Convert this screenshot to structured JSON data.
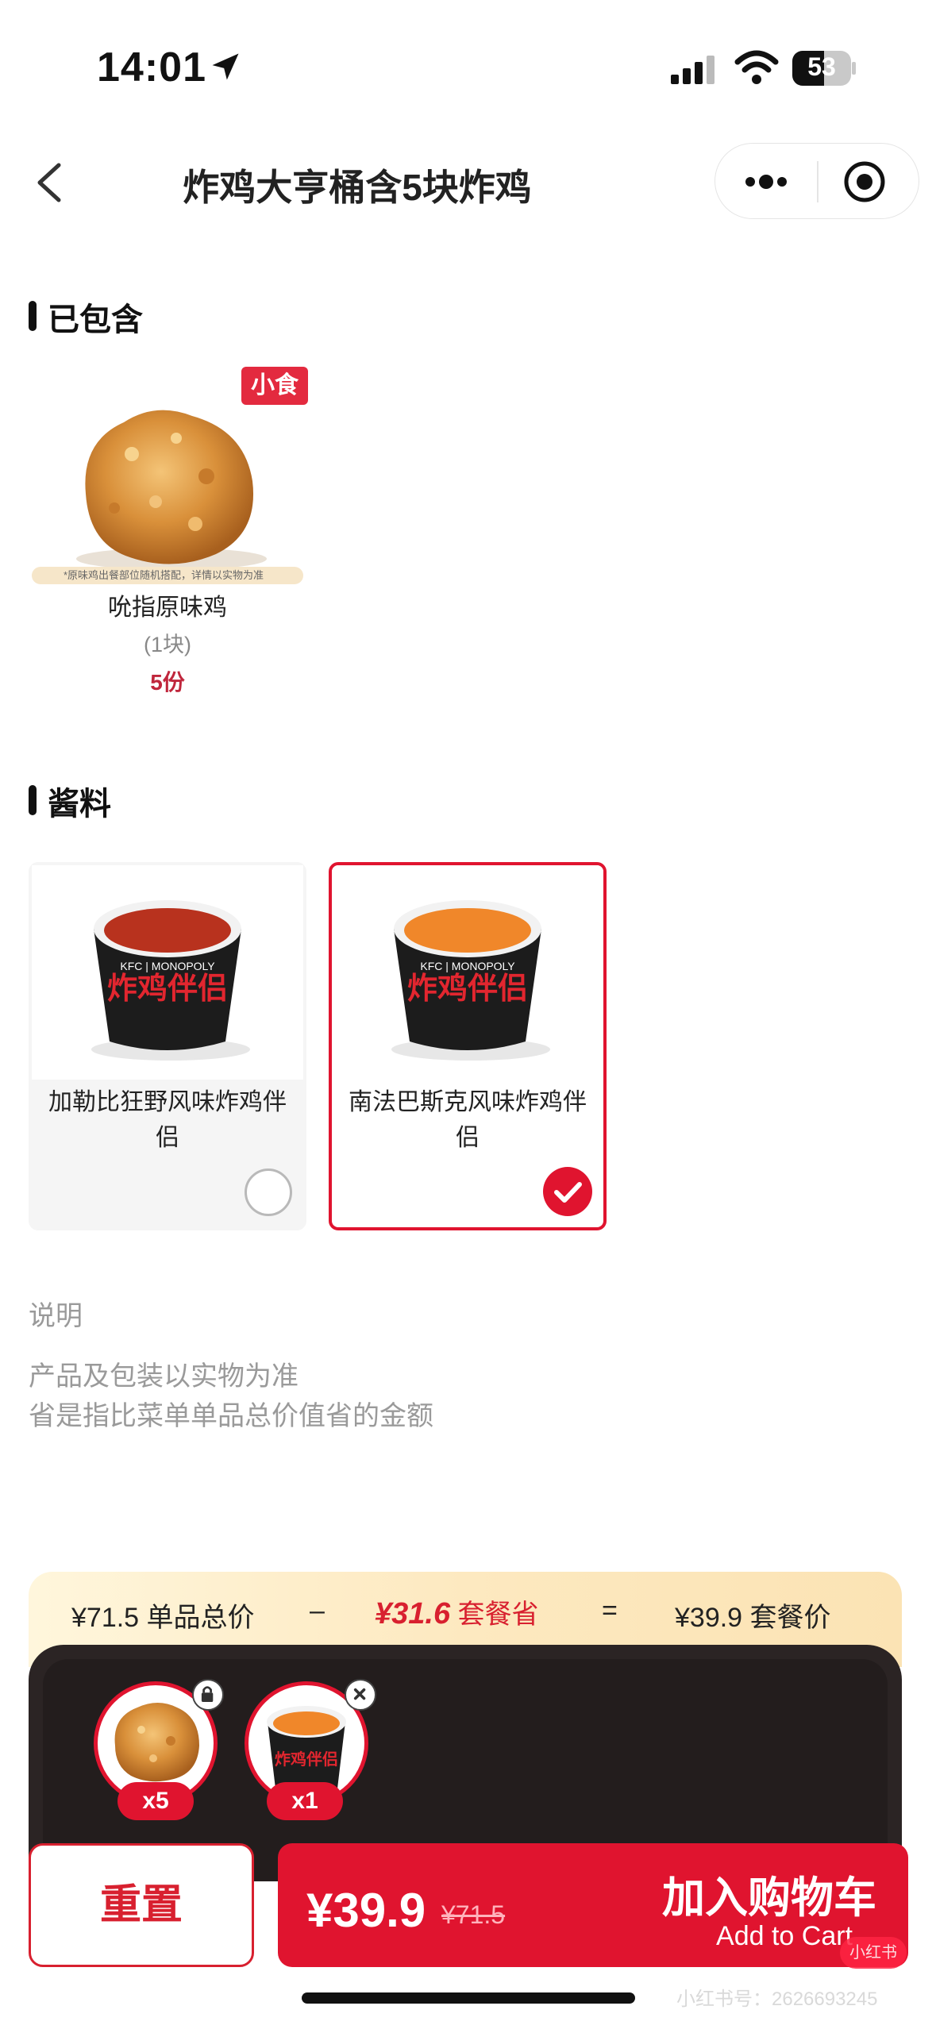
{
  "status": {
    "time": "14:01",
    "battery": "53"
  },
  "nav": {
    "title": "炸鸡大亨桶含5块炸鸡"
  },
  "included": {
    "heading": "已包含",
    "items": [
      {
        "tag": "小食",
        "note": "*原味鸡出餐部位随机搭配，详情以实物为准",
        "name": "吮指原味鸡",
        "unit": "(1块)",
        "qty": "5份"
      }
    ]
  },
  "sauce": {
    "heading": "酱料",
    "options": [
      {
        "name": "加勒比狂野风味炸鸡伴侣",
        "selected": false,
        "sauce_color": "#b8321e"
      },
      {
        "name": "南法巴斯克风味炸鸡伴侣",
        "selected": true,
        "sauce_color": "#f0872a"
      }
    ],
    "cup_label": "炸鸡伴侣",
    "cup_brand": "KFC | MONOPOLY"
  },
  "description": {
    "title": "说明",
    "lines": [
      "产品及包装以实物为准",
      "省是指比菜单单品总价值省的金额"
    ]
  },
  "summary": {
    "total_value": "¥71.5",
    "total_label": "单品总价",
    "minus": "–",
    "save_value": "¥31.6",
    "save_label": "套餐省",
    "equals": "=",
    "combo_value": "¥39.9",
    "combo_label": "套餐价"
  },
  "tray": {
    "items": [
      {
        "qty": "x5"
      },
      {
        "qty": "x1"
      }
    ]
  },
  "actions": {
    "reset": "重置",
    "price": "¥39.9",
    "orig_price": "¥71.5",
    "add_cn": "加入购物车",
    "add_en": "Add to Cart"
  },
  "watermark": {
    "logo": "小红书",
    "text": "小红书号：2626693245"
  },
  "colors": {
    "brand_red": "#e0142f",
    "accent_red": "#d8202f"
  }
}
